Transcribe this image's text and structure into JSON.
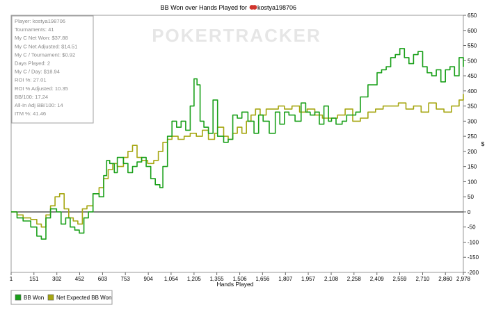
{
  "chart_data": {
    "type": "line",
    "title": "BB Won over Hands Played for",
    "player_name": "kostya198706",
    "watermark": "POKERTRACKER",
    "xlabel": "Hands Played",
    "ylabel": "$",
    "x_ticks": [
      1,
      151,
      302,
      452,
      603,
      753,
      904,
      1054,
      1205,
      1355,
      1506,
      1656,
      1807,
      1957,
      2108,
      2258,
      2409,
      2559,
      2710,
      2860,
      2978
    ],
    "y_ticks": [
      -200,
      -150,
      -100,
      -50,
      0,
      50,
      100,
      150,
      200,
      250,
      300,
      350,
      400,
      450,
      500,
      550,
      600,
      650
    ],
    "xlim": [
      1,
      2978
    ],
    "ylim": [
      -200,
      650
    ],
    "grid": false,
    "legend_position": "bottom-left",
    "colors": {
      "bb_won": "#1aa01a",
      "expected": "#a6a611",
      "zero_line": "#000000"
    },
    "series": [
      {
        "name": "BB Won",
        "x": [
          1,
          40,
          80,
          130,
          170,
          200,
          230,
          260,
          300,
          330,
          360,
          390,
          420,
          450,
          480,
          510,
          540,
          580,
          610,
          630,
          650,
          680,
          700,
          740,
          770,
          800,
          830,
          860,
          890,
          920,
          950,
          980,
          1000,
          1030,
          1060,
          1090,
          1120,
          1150,
          1180,
          1205,
          1225,
          1245,
          1270,
          1300,
          1330,
          1360,
          1400,
          1430,
          1460,
          1490,
          1520,
          1560,
          1600,
          1630,
          1660,
          1700,
          1740,
          1770,
          1800,
          1830,
          1870,
          1910,
          1940,
          1970,
          2000,
          2030,
          2060,
          2090,
          2110,
          2140,
          2180,
          2210,
          2240,
          2270,
          2300,
          2320,
          2350,
          2380,
          2410,
          2440,
          2470,
          2500,
          2530,
          2560,
          2590,
          2620,
          2650,
          2680,
          2710,
          2740,
          2770,
          2800,
          2830,
          2860,
          2890,
          2920,
          2950,
          2978
        ],
        "y": [
          0,
          -20,
          -30,
          -50,
          -80,
          -90,
          -20,
          10,
          0,
          -40,
          -20,
          -50,
          -60,
          -70,
          -20,
          0,
          60,
          50,
          120,
          170,
          160,
          130,
          180,
          160,
          130,
          150,
          165,
          180,
          150,
          110,
          90,
          80,
          150,
          250,
          300,
          280,
          300,
          270,
          350,
          440,
          420,
          300,
          280,
          260,
          370,
          250,
          230,
          240,
          320,
          310,
          330,
          300,
          260,
          320,
          300,
          260,
          330,
          290,
          330,
          320,
          300,
          360,
          330,
          320,
          330,
          290,
          350,
          300,
          310,
          290,
          300,
          320,
          320,
          330,
          380,
          380,
          420,
          420,
          460,
          470,
          480,
          510,
          520,
          540,
          510,
          490,
          520,
          530,
          480,
          460,
          450,
          470,
          430,
          470,
          480,
          450,
          510,
          480
        ]
      },
      {
        "name": "Net Expected BB Won",
        "x": [
          1,
          40,
          80,
          130,
          170,
          200,
          230,
          260,
          290,
          320,
          350,
          380,
          410,
          440,
          470,
          500,
          540,
          580,
          610,
          640,
          670,
          700,
          740,
          770,
          800,
          830,
          860,
          900,
          940,
          970,
          1000,
          1030,
          1060,
          1100,
          1140,
          1180,
          1220,
          1260,
          1300,
          1340,
          1360,
          1400,
          1430,
          1460,
          1490,
          1520,
          1550,
          1580,
          1610,
          1640,
          1680,
          1720,
          1760,
          1800,
          1850,
          1900,
          1950,
          2000,
          2050,
          2100,
          2150,
          2200,
          2250,
          2300,
          2350,
          2400,
          2450,
          2500,
          2550,
          2600,
          2650,
          2700,
          2750,
          2800,
          2850,
          2900,
          2950,
          2978
        ],
        "y": [
          0,
          -10,
          -20,
          -25,
          -40,
          -50,
          -10,
          20,
          50,
          60,
          10,
          -20,
          -30,
          -40,
          10,
          20,
          60,
          80,
          110,
          140,
          160,
          150,
          180,
          200,
          220,
          180,
          170,
          160,
          170,
          200,
          230,
          240,
          250,
          240,
          250,
          260,
          250,
          270,
          240,
          260,
          280,
          250,
          240,
          260,
          280,
          260,
          300,
          320,
          340,
          320,
          340,
          340,
          350,
          340,
          350,
          330,
          340,
          320,
          310,
          310,
          320,
          340,
          300,
          310,
          330,
          340,
          350,
          350,
          360,
          340,
          350,
          330,
          360,
          340,
          330,
          350,
          370,
          390
        ]
      }
    ]
  },
  "stats_box": {
    "lines": [
      "Player: kostya198706",
      "Tournaments: 41",
      "My C Net Won: $37.88",
      "My C Net Adjusted: $14.51",
      "My C / Tournament: $0.92",
      "Days Played: 2",
      "My C / Day: $18.94",
      "ROI %: 27.01",
      "ROI % Adjusted: 10.35",
      "BB/100: 17.24",
      "All-In Adj BB/100: 14",
      "ITM %: 41.46"
    ]
  }
}
